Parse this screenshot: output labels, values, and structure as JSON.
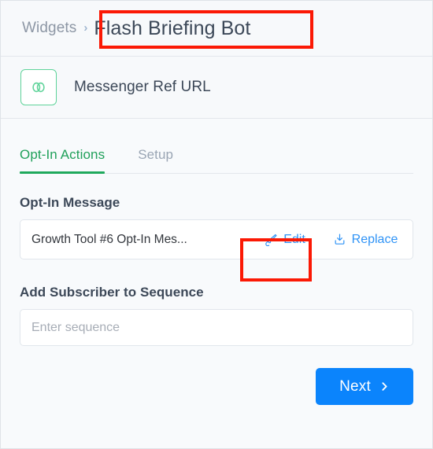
{
  "breadcrumb": {
    "parent": "Widgets",
    "separator": "›",
    "current": "Flash Briefing Bot"
  },
  "entity": {
    "icon": "chain-link-icon",
    "name": "Messenger Ref URL",
    "icon_color": "#5fd39a"
  },
  "tabs": [
    {
      "label": "Opt-In Actions",
      "active": true
    },
    {
      "label": "Setup",
      "active": false
    }
  ],
  "opt_in_message": {
    "label": "Opt-In Message",
    "value": "Growth Tool #6 Opt-In Mes...",
    "edit_label": "Edit",
    "edit_icon": "pen-nib-icon",
    "replace_label": "Replace",
    "replace_icon": "download-tray-icon"
  },
  "sequence": {
    "label": "Add Subscriber to Sequence",
    "value": "",
    "placeholder": "Enter sequence"
  },
  "footer": {
    "next_label": "Next",
    "next_icon": "chevron-right-icon"
  },
  "annotations": [
    {
      "name": "title-highlight",
      "color": "#fb1905"
    },
    {
      "name": "edit-highlight",
      "color": "#fb1905"
    }
  ],
  "colors": {
    "accent_green": "#1fa95c",
    "accent_blue": "#0b84fc",
    "link_blue": "#2f93f6",
    "annotation_red": "#fb1905",
    "text_dark": "#3c4858",
    "text_muted": "#9aa5b4"
  }
}
